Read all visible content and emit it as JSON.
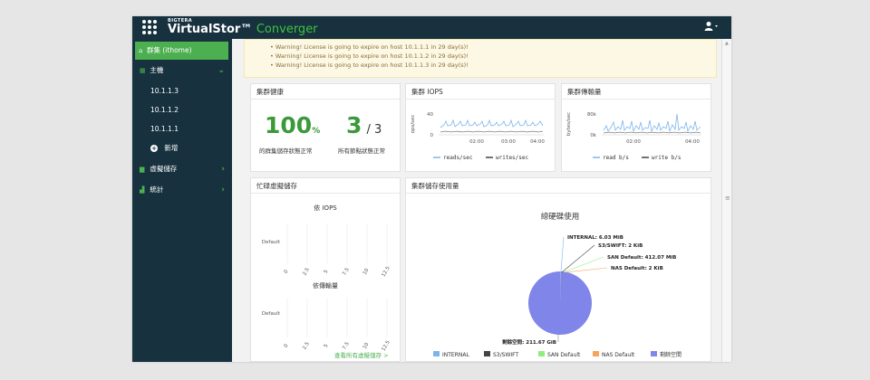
{
  "app": {
    "brand_small": "BIGTERA",
    "brand_name": "VirtualStor™",
    "brand_product": "Converger"
  },
  "colors": {
    "navy": "#17313f",
    "green": "#4caf50",
    "warn_bg": "#fcf8e3",
    "warn_text": "#8a6d3b",
    "series_blue": "#7cb5ec",
    "series_dark": "#434348",
    "series_green": "#90ed7d",
    "series_orange": "#f7a35c",
    "series_purple": "#8085e9"
  },
  "sidebar": {
    "cluster_label": "群集 (ithome)",
    "hosts_label": "主機",
    "hosts": [
      "10.1.1.3",
      "10.1.1.2",
      "10.1.1.1"
    ],
    "add_label": "新增",
    "vstorage_label": "虛擬儲存",
    "stats_label": "統計"
  },
  "warnings": [
    "Warning! License is going to expire on host 10.1.1.1 in 29 day(s)!",
    "Warning! License is going to expire on host 10.1.1.2 in 29 day(s)!",
    "Warning! License is going to expire on host 10.1.1.3 in 29 day(s)!"
  ],
  "health": {
    "title": "集群健康",
    "disk_percent": "100",
    "disk_unit": "%",
    "disk_caption": "的群集儲存狀態正常",
    "nodes_ok": "3",
    "nodes_total": "/ 3",
    "nodes_caption": "所有節點狀態正常"
  },
  "iops": {
    "title": "集群 IOPS",
    "ylabel": "ops/sec",
    "yticks": [
      "40",
      "0"
    ],
    "xticks": [
      "02:00",
      "03:00",
      "04:00"
    ],
    "legend": [
      "reads/sec",
      "writes/sec"
    ]
  },
  "throughput": {
    "title": "集群傳輸量",
    "ylabel": "bytes/sec",
    "yticks": [
      "80k",
      "0k"
    ],
    "xticks": [
      "02:00",
      "04:00"
    ],
    "legend": [
      "read b/s",
      "write b/s"
    ]
  },
  "busy": {
    "title": "忙碌虛擬儲存",
    "iops_title": "依 IOPS",
    "io_title": "依傳輸量",
    "category": "Default",
    "xticks": [
      "0",
      "2.5",
      "5",
      "7.5",
      "10",
      "12.5"
    ],
    "link": "查看所有虛擬儲存 >"
  },
  "usage": {
    "title": "集群儲存使用量",
    "chart_title": "總硬碟使用"
  },
  "chart_data": {
    "type": "pie",
    "title": "總硬碟使用",
    "slices": [
      {
        "name": "INTERNAL",
        "label": "INTERNAL: 6.03 MiB",
        "value_mib": 6.03,
        "color": "#7cb5ec"
      },
      {
        "name": "S3/SWIFT",
        "label": "S3/SWIFT: 2 KiB",
        "value_mib": 0.002,
        "color": "#434348"
      },
      {
        "name": "SAN Default",
        "label": "SAN Default: 412.07 MiB",
        "value_mib": 412.07,
        "color": "#90ed7d"
      },
      {
        "name": "NAS Default",
        "label": "NAS Default: 2 KiB",
        "value_mib": 0.002,
        "color": "#f7a35c"
      },
      {
        "name": "剩餘空間",
        "label": "剩餘空間: 211.67 GiB",
        "value_mib": 216750.08,
        "color": "#8085e9"
      }
    ],
    "legend_position": "bottom"
  }
}
